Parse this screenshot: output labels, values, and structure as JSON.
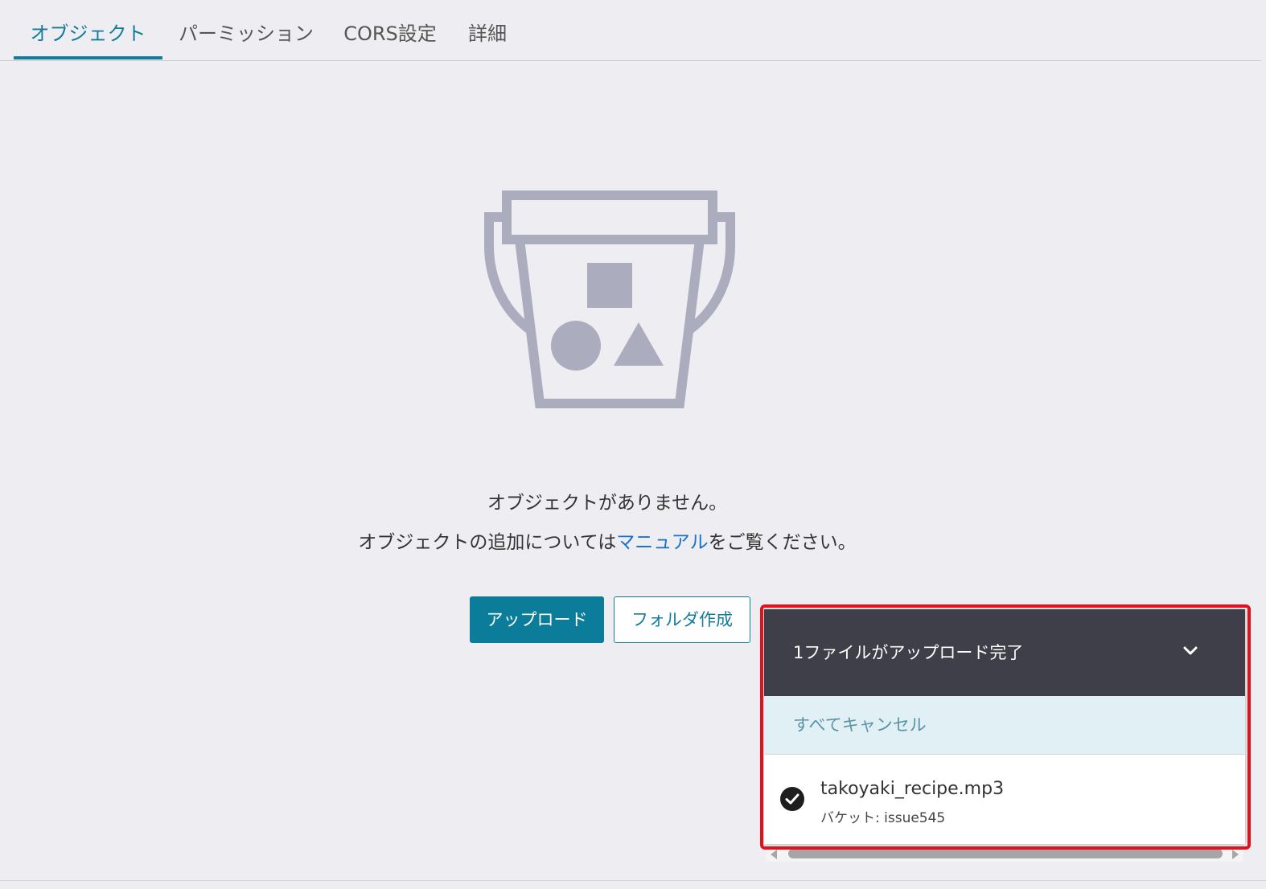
{
  "tabs": [
    {
      "label": "オブジェクト",
      "active": true
    },
    {
      "label": "パーミッション",
      "active": false
    },
    {
      "label": "CORS設定",
      "active": false
    },
    {
      "label": "詳細",
      "active": false
    }
  ],
  "empty_state": {
    "icon": "bucket-icon",
    "title": "オブジェクトがありません。",
    "desc_before": "オブジェクトの追加については",
    "desc_link": "マニュアル",
    "desc_after": "をご覧ください。"
  },
  "buttons": {
    "upload": "アップロード",
    "create_folder": "フォルダ作成"
  },
  "upload_panel": {
    "title": "1ファイルがアップロード完了",
    "cancel_all": "すべてキャンセル",
    "files": [
      {
        "name": "takoyaki_recipe.mp3",
        "bucket": "バケット: issue545",
        "status_icon": "check-circle-icon"
      }
    ]
  },
  "colors": {
    "accent": "#147c99",
    "primary_button": "#0b7d9b",
    "link": "#1a73c9",
    "panel_header": "#3e3f49",
    "highlight": "#e0121b",
    "icon_gray": "#abacbd"
  }
}
